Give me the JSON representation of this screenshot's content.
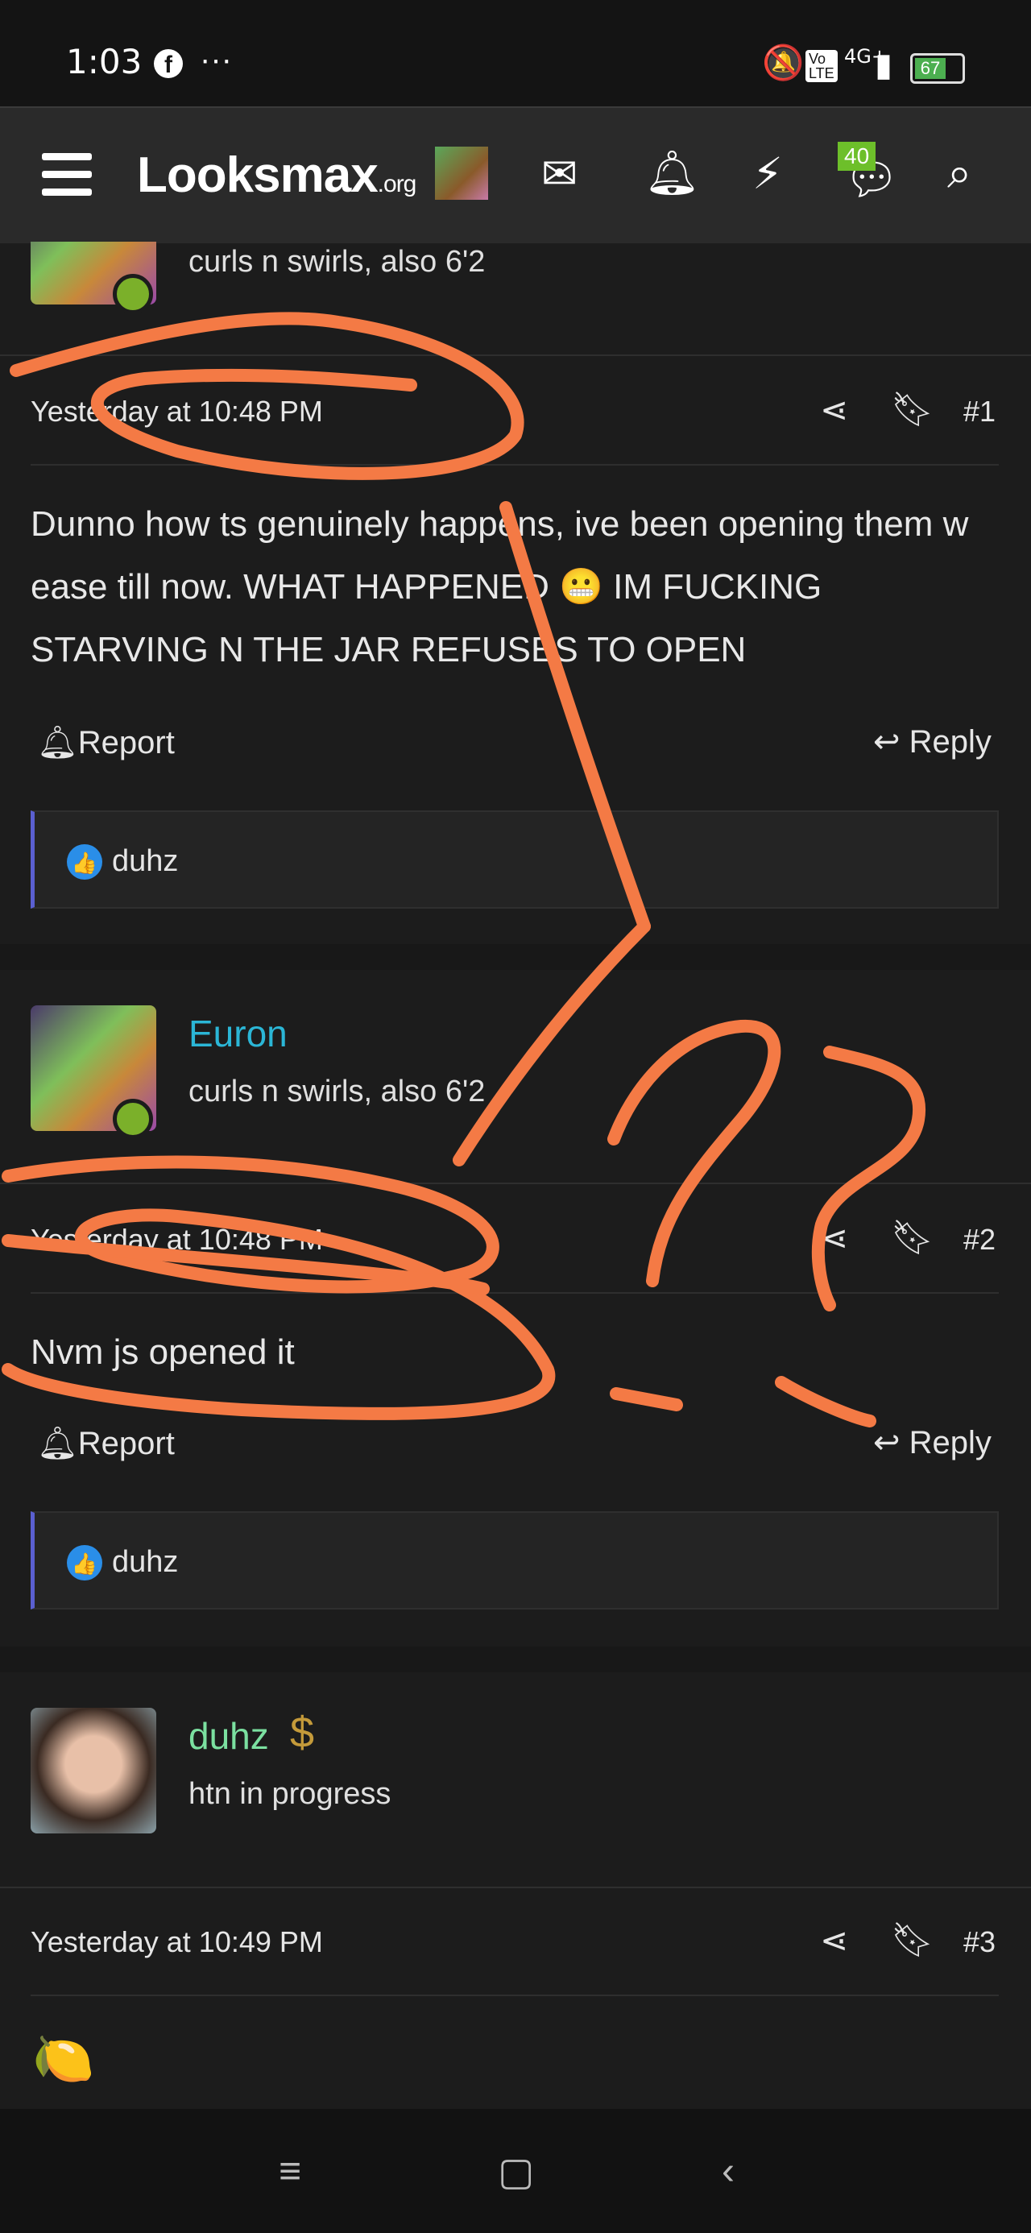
{
  "status_bar": {
    "time": "1:03",
    "fb": "f",
    "more": "···",
    "signal_text": "4G+",
    "battery": "67"
  },
  "nav": {
    "logo_main": "Looksmax",
    "logo_tld": ".org",
    "badge_count": "40",
    "icons": [
      "menu-icon",
      "mail-icon",
      "bell-icon",
      "bolt-icon",
      "chat-icon",
      "search-icon"
    ]
  },
  "posts": [
    {
      "author": "",
      "user_title": "curls n swirls, also 6'2",
      "timestamp": "Yesterday at 10:48 PM",
      "number": "#1",
      "body": "Dunno how ts genuinely happens, ive been opening them w ease till now. WHAT HAPPENED 😬 IM FUCKING STARVING N THE JAR REFUSES TO OPEN",
      "report": "Report",
      "reply": "Reply",
      "reaction_user": "duhz"
    },
    {
      "author": "Euron",
      "user_title": "curls n swirls, also 6'2",
      "timestamp": "Yesterday at 10:48 PM",
      "number": "#2",
      "body": "Nvm js opened it",
      "report": "Report",
      "reply": "Reply",
      "reaction_user": "duhz"
    },
    {
      "author": "duhz",
      "user_title": "htn in progress",
      "timestamp": "Yesterday at 10:49 PM",
      "number": "#3",
      "badge": "$",
      "body_emoji": "🍋"
    }
  ],
  "colors": {
    "accent_blue": "#2bb6d6",
    "accent_green": "#7be0a0",
    "scribble": "#f47a45",
    "reaction_bar": "#5a5fd0"
  }
}
